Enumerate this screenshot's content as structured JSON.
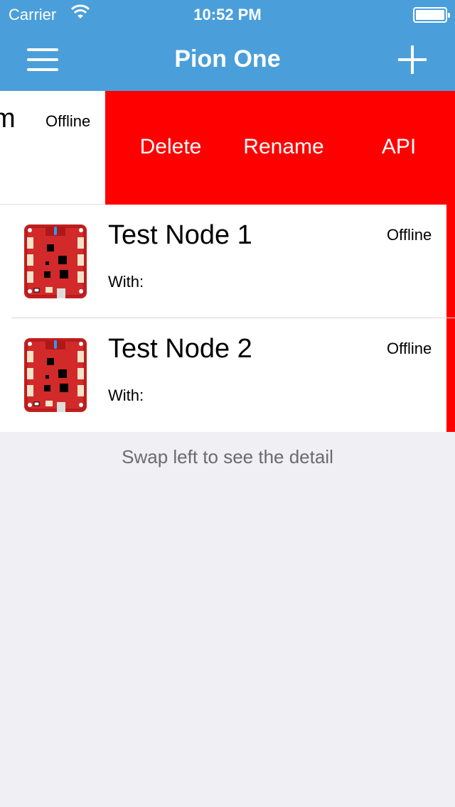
{
  "status_bar": {
    "carrier": "Carrier",
    "time": "10:52 PM"
  },
  "nav": {
    "title": "Pion One",
    "menu_icon": "hamburger-menu-icon",
    "add_icon": "plus-icon"
  },
  "colors": {
    "nav_bg": "#4a9fda",
    "action_red": "#ff0000",
    "page_bg": "#efeff4"
  },
  "swiped_row": {
    "partial_name": "m",
    "status": "Offline",
    "actions": [
      "Delete",
      "Rename",
      "API"
    ]
  },
  "nodes": [
    {
      "name": "Test Node 1",
      "with_label": "With:",
      "status": "Offline"
    },
    {
      "name": "Test Node 2",
      "with_label": "With:",
      "status": "Offline"
    }
  ],
  "hint": "Swap left to see the detail"
}
